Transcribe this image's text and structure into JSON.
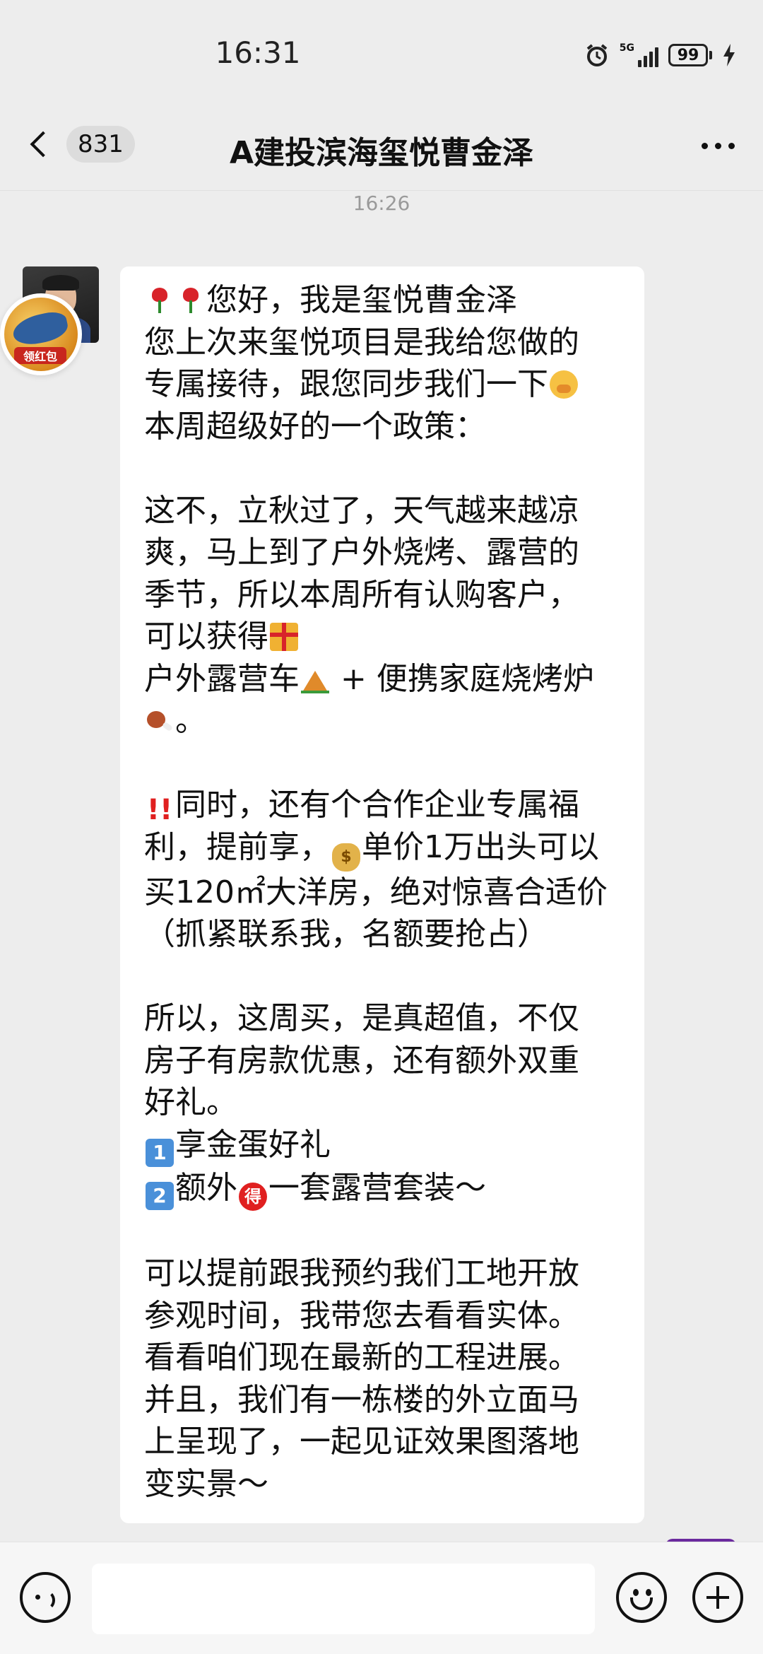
{
  "status_bar": {
    "time": "16:31",
    "network": "5G",
    "battery": "99"
  },
  "header": {
    "back_badge": "831",
    "title": "A建投滨海玺悦曹金泽"
  },
  "chat": {
    "timestamp": "16:26",
    "red_packet_label": "领红包",
    "message_lines": [
      {
        "pre": [
          "rose",
          "rose"
        ],
        "text": "您好，我是玺悦曹金泽"
      },
      {
        "text": "您上次来玺悦项目是我给您做的"
      },
      {
        "text": "专属接待，跟您同步我们一下",
        "post": [
          "face"
        ]
      },
      {
        "text": "本周超级好的一个政策："
      },
      {
        "text": ""
      },
      {
        "text": "这不，立秋过了，天气越来越凉"
      },
      {
        "text": "爽，马上到了户外烧烤、露营的"
      },
      {
        "text": "季节，所以本周所有认购客户，"
      },
      {
        "text": "可以获得",
        "post": [
          "gift"
        ]
      },
      {
        "text": "户外露营车",
        "post": [
          "tent"
        ],
        "text2": " + 便携家庭烧烤炉"
      },
      {
        "pre": [
          "meat"
        ],
        "text": "。"
      },
      {
        "text": ""
      },
      {
        "pre": [
          "bang"
        ],
        "text": "同时，还有个合作企业专属福"
      },
      {
        "text": "利，提前享，",
        "post": [
          "bag"
        ],
        "text2": "单价1万出头可以"
      },
      {
        "text": "买120㎡大洋房，绝对惊喜合适价"
      },
      {
        "text": "（抓紧联系我，名额要抢占）"
      },
      {
        "text": ""
      },
      {
        "text": "所以，这周买，是真超值，不仅"
      },
      {
        "text": "房子有房款优惠，还有额外双重"
      },
      {
        "text": "好礼。"
      },
      {
        "pre": [
          "k1"
        ],
        "text": "享金蛋好礼"
      },
      {
        "pre": [
          "k2"
        ],
        "text": "额外",
        "post": [
          "de"
        ],
        "text2": "一套露营套装～"
      },
      {
        "text": ""
      },
      {
        "text": "可以提前跟我预约我们工地开放"
      },
      {
        "text": "参观时间，我带您去看看实体。"
      },
      {
        "text": "看看咱们现在最新的工程进展。"
      },
      {
        "text": "并且，我们有一栋楼的外立面马"
      },
      {
        "text": "上呈现了，一起见证效果图落地"
      },
      {
        "text": "变实景～"
      }
    ]
  },
  "icons": {
    "back": "chevron-left-icon",
    "more": "more-dots-icon",
    "voice": "voice-icon",
    "emoji": "emoji-icon",
    "plus": "plus-icon"
  },
  "colors": {
    "background": "#ededed",
    "bubble_in": "#ffffff",
    "bubble_out": "#95ec69"
  }
}
